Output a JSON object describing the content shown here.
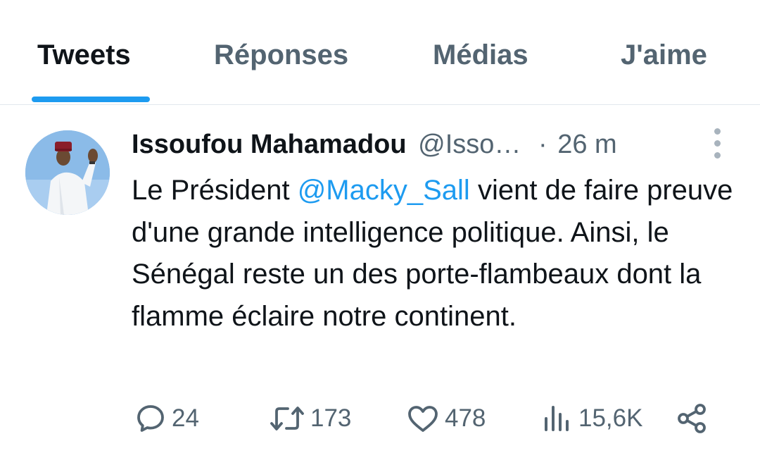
{
  "tabs": [
    {
      "label": "Tweets",
      "active": true
    },
    {
      "label": "Réponses",
      "active": false
    },
    {
      "label": "Médias",
      "active": false
    },
    {
      "label": "J'aime",
      "active": false
    }
  ],
  "tweet": {
    "author_name": "Issoufou Mahamadou",
    "author_handle": "@Isso…",
    "time_separator": "·",
    "time_ago": "26 m",
    "text_before_mention": "Le Président ",
    "mention": "@Macky_Sall",
    "text_after_mention": " vient de faire preuve d'une grande intelligence politique. Ainsi, le Sénégal reste un des porte-flambeaux dont la flamme éclaire notre continent.",
    "actions": {
      "replies": "24",
      "retweets": "173",
      "likes": "478",
      "views": "15,6K"
    },
    "icons": {
      "reply": "reply-icon",
      "retweet": "retweet-icon",
      "like": "heart-icon",
      "views": "views-icon",
      "share": "share-icon",
      "more": "more-vertical-icon"
    }
  },
  "colors": {
    "accent": "#1d9bf0",
    "text_primary": "#0f1419",
    "text_secondary": "#536471",
    "divider": "#e1e8ed"
  }
}
